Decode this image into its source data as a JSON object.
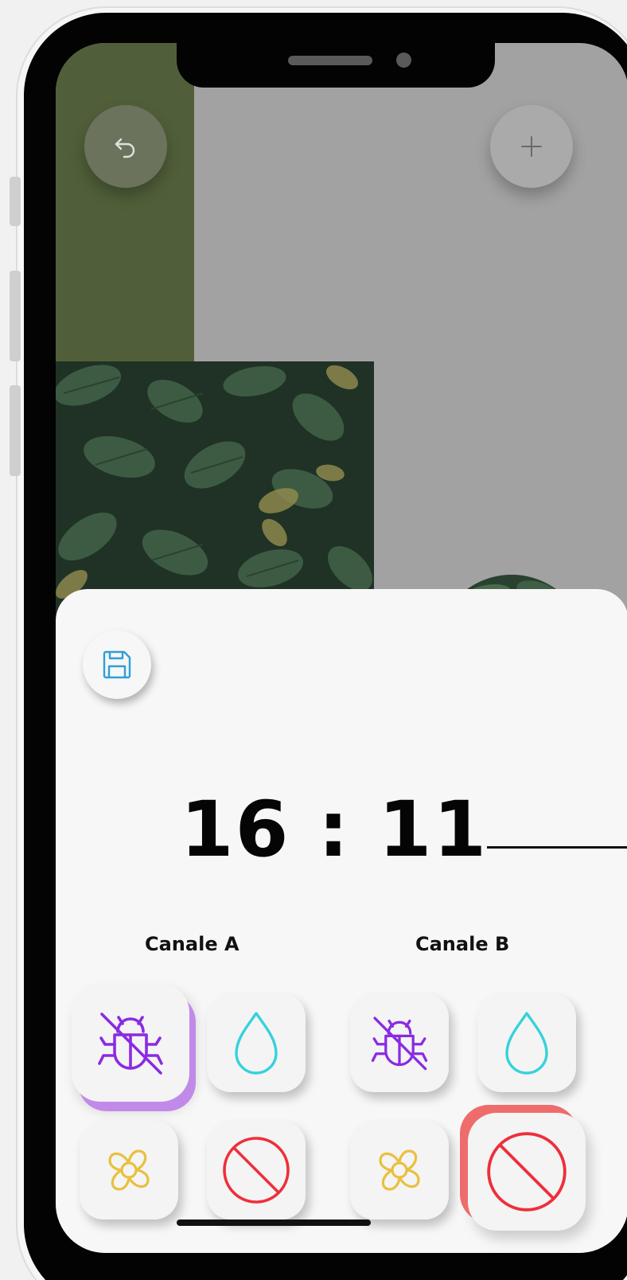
{
  "sheet": {
    "time": "16 : 11",
    "channels": [
      {
        "label": "Canale A"
      },
      {
        "label": "Canale B"
      }
    ]
  },
  "icons": {
    "back": "undo-arrow-icon",
    "add": "plus-icon",
    "save": "floppy-disk-icon",
    "tiles": [
      "bug-off-icon",
      "water-drop-icon",
      "flower-icon",
      "block-icon"
    ]
  },
  "colors": {
    "image_overlay": "#a2a2a2",
    "green_panel": "#505f39",
    "sheet_background": "#f7f7f7",
    "bug_icon": "#8a2be2",
    "drop_icon": "#35d2dc",
    "flower_icon": "#e9c03e",
    "block_icon": "#ee2f3a",
    "save_icon": "#2f9fd8",
    "pressed_purple": "#c18ae8",
    "pressed_red": "#ee6c6c"
  }
}
